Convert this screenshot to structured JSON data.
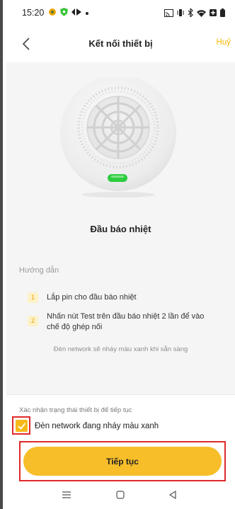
{
  "status_bar": {
    "time": "15:20",
    "left_icons": [
      "notification-dot-icon",
      "shield-icon",
      "media-icon",
      "dot-icon"
    ],
    "right_icons": [
      "cast-icon",
      "vibrate-icon",
      "bluetooth-icon",
      "wifi-icon",
      "battery-saver-icon",
      "battery-icon"
    ]
  },
  "header": {
    "title": "Kết nối thiết bị",
    "cancel_label": "Huỷ"
  },
  "device": {
    "name": "Đầu báo nhiệt",
    "led_color": "#2ecc40"
  },
  "guide": {
    "title": "Hướng dẫn",
    "steps": [
      {
        "number": "1",
        "text": "Lắp pin cho đầu báo nhiệt"
      },
      {
        "number": "2",
        "text": "Nhấn nút Test trên đầu báo nhiệt 2 lần để vào chế độ ghép nối"
      }
    ],
    "note": "Đèn network sẽ nháy màu xanh khi sẵn sàng"
  },
  "confirm": {
    "label": "Xác nhận trạng thái thiết bị để tiếp tục",
    "checkbox_text": "Đèn network đang nháy màu xanh",
    "checked": true
  },
  "primary_button": {
    "label": "Tiếp tục"
  },
  "colors": {
    "accent": "#f7be2a",
    "cancel_text": "#f5b800",
    "highlight_border": "#e02a2a"
  },
  "nav": [
    "menu-icon",
    "home-icon",
    "back-icon"
  ]
}
